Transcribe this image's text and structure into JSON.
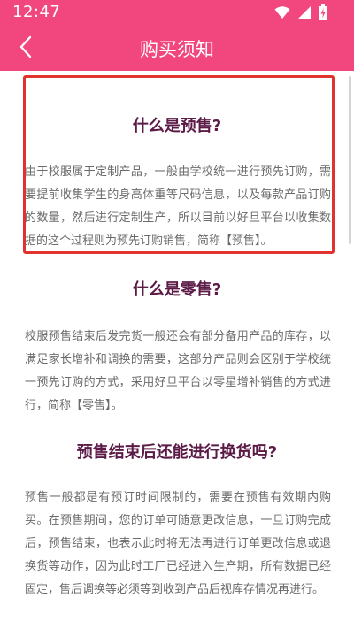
{
  "status_bar": {
    "time": "12:47",
    "icons": [
      "wifi-icon",
      "cell-signal-icon",
      "battery-charging-icon"
    ]
  },
  "header": {
    "title": "购买须知",
    "back_icon": "chevron-left-icon",
    "background_color": "#f2467f"
  },
  "sections": [
    {
      "title": "什么是预售?",
      "body": "由于校服属于定制产品，一般由学校统一进行预先订购，需要提前收集学生的身高体重等尺码信息，以及每款产品订购的数量，然后进行定制生产，所以目前以好旦平台以收集数据的这个过程则为预先订购销售，简称【预售】。",
      "highlighted": true
    },
    {
      "title": "什么是零售?",
      "body": "校服预售结束后发完货一般还会有部分备用产品的库存，以满足家长增补和调换的需要，这部分产品则会区别于学校统一预先订购的方式，采用好旦平台以零星增补销售的方式进行，简称【零售】。"
    },
    {
      "title": "预售结束后还能进行换货吗?",
      "body": "预售一般都是有预订时间限制的，需要在预售有效期内购买。在预售期间，您的订单可随意更改信息，一旦订购完成后，预售结束，也表示此时将无法再进行订单更改信息或退换货等动作，因为此时工厂已经进入生产期，所有数据已经固定，售后调换等必须等到收到产品后视库存情况再进行。"
    }
  ],
  "colors": {
    "title_text": "#5c1a47",
    "body_text": "#6a6a6a",
    "highlight_border": "#e0322f"
  }
}
